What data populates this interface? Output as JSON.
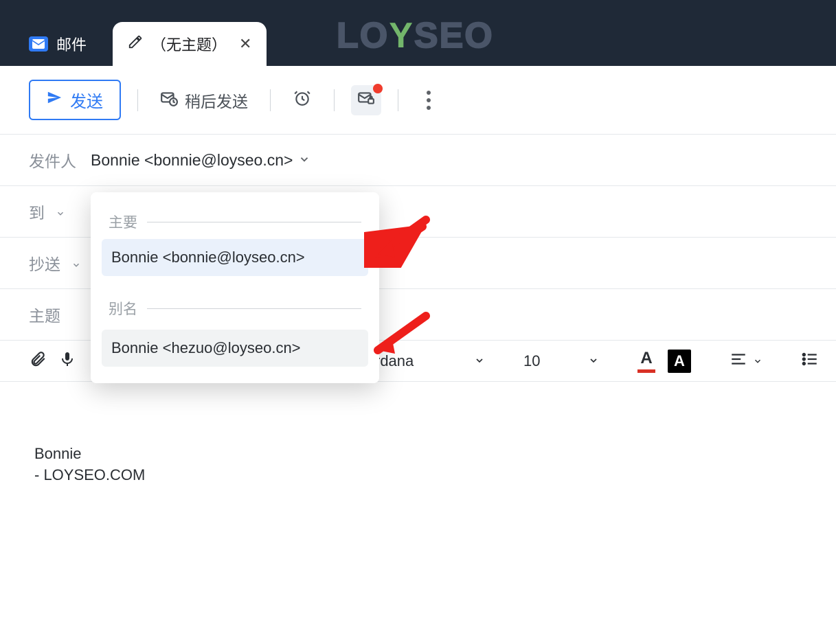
{
  "tabs": {
    "mail_label": "邮件",
    "compose_label": "（无主题）"
  },
  "watermark": {
    "prefix": "LO",
    "heart": "Y",
    "suffix": "SEO"
  },
  "toolbar": {
    "send_label": "发送",
    "later_label": "稍后发送"
  },
  "fields": {
    "from_label": "发件人",
    "from_value": "Bonnie <bonnie@loyseo.cn>",
    "to_label": "到",
    "cc_label": "抄送",
    "subject_label": "主题"
  },
  "dropdown": {
    "primary_title": "主要",
    "primary_item": "Bonnie <bonnie@loyseo.cn>",
    "alias_title": "别名",
    "alias_item": "Bonnie <hezuo@loyseo.cn>"
  },
  "format": {
    "font_name": "rdana",
    "font_size": "10"
  },
  "body": {
    "line1": "Bonnie",
    "line2": "- LOYSEO.COM"
  }
}
